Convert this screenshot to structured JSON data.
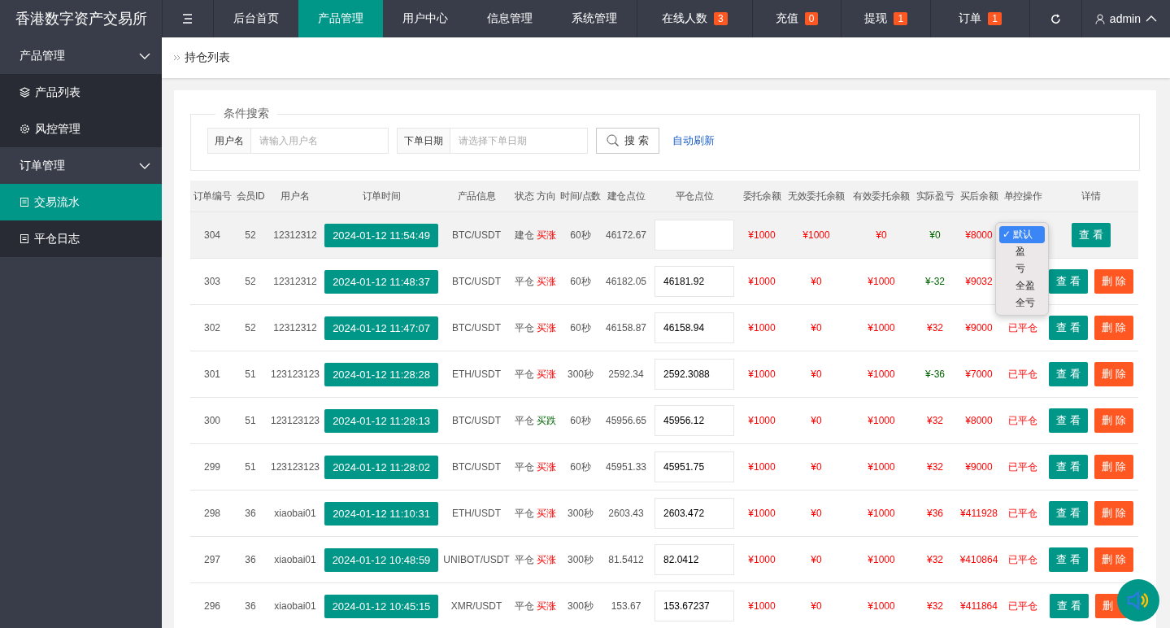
{
  "brand": "香港数字资产交易所",
  "top_nav": [
    {
      "label": "后台首页",
      "selected": false
    },
    {
      "label": "产品管理",
      "selected": true
    },
    {
      "label": "用户中心",
      "selected": false
    },
    {
      "label": "信息管理",
      "selected": false
    },
    {
      "label": "系统管理",
      "selected": false
    }
  ],
  "top_stats": [
    {
      "label": "在线人数",
      "count": "3"
    },
    {
      "label": "充值",
      "count": "0"
    },
    {
      "label": "提现",
      "count": "1"
    },
    {
      "label": "订单",
      "count": "1"
    }
  ],
  "user": "admin",
  "sidebar": [
    {
      "label": "产品管理",
      "expanded": true,
      "children": [
        {
          "label": "产品列表",
          "kind": "layers",
          "selected": false
        },
        {
          "label": "风控管理",
          "kind": "gear",
          "selected": false
        }
      ]
    },
    {
      "label": "订单管理",
      "expanded": true,
      "children": [
        {
          "label": "交易流水",
          "kind": "doc",
          "selected": true
        },
        {
          "label": "平仓日志",
          "kind": "doc",
          "selected": false
        }
      ]
    }
  ],
  "breadcrumb": "持仓列表",
  "search": {
    "legend": "条件搜索",
    "fields": [
      {
        "label": "用户名",
        "placeholder": "请输入用户名"
      },
      {
        "label": "下单日期",
        "placeholder": "请选择下单日期"
      }
    ],
    "button": "搜 索",
    "link": "自动刷新"
  },
  "table": {
    "columns": [
      "订单编号",
      "会员ID",
      "用户名",
      "订单时间",
      "产品信息",
      "状态",
      "方向",
      "时间/点数",
      "建仓点位",
      "平仓点位",
      "委托余额",
      "无效委托余额",
      "有效委托余额",
      "实际盈亏",
      "买后余额",
      "单控操作",
      "详情"
    ],
    "rows": [
      {
        "id": "304",
        "member": "52",
        "user": "12312312",
        "time": "2024-01-12 11:54:49",
        "product": "BTC/USDT",
        "status": "建仓",
        "direction": "买涨",
        "up": true,
        "period": "60秒",
        "open": "46172.67",
        "close": "",
        "amount": "¥1000",
        "invalid": "¥1000",
        "valid": "¥0",
        "pnl": "¥0",
        "pnl_loss": true,
        "balance": "¥8000",
        "control": {
          "kind": "menu",
          "options": [
            {
              "label": "默认",
              "mark": "✓",
              "selected": true
            },
            {
              "label": "盈",
              "selected": false
            },
            {
              "label": "亏",
              "selected": false
            },
            {
              "label": "全盈",
              "selected": false
            },
            {
              "label": "全亏",
              "selected": false
            }
          ]
        },
        "actions": [
          "查 看"
        ],
        "highlighted": true
      },
      {
        "id": "303",
        "member": "52",
        "user": "12312312",
        "time": "2024-01-12 11:48:37",
        "product": "BTC/USDT",
        "status": "平仓",
        "direction": "买涨",
        "up": true,
        "period": "60秒",
        "open": "46182.05",
        "close": "46181.92",
        "amount": "¥1000",
        "invalid": "¥0",
        "valid": "¥1000",
        "pnl": "¥-32",
        "pnl_loss": true,
        "balance": "¥9032",
        "control": {
          "kind": "hidden"
        },
        "actions": [
          "查 看",
          "删 除"
        ],
        "highlighted": false
      },
      {
        "id": "302",
        "member": "52",
        "user": "12312312",
        "time": "2024-01-12 11:47:07",
        "product": "BTC/USDT",
        "status": "平仓",
        "direction": "买涨",
        "up": true,
        "period": "60秒",
        "open": "46158.87",
        "close": "46158.94",
        "amount": "¥1000",
        "invalid": "¥0",
        "valid": "¥1000",
        "pnl": "¥32",
        "pnl_loss": false,
        "balance": "¥9000",
        "control": {
          "kind": "text",
          "label": "已平仓"
        },
        "actions": [
          "查 看",
          "删 除"
        ],
        "highlighted": false
      },
      {
        "id": "301",
        "member": "51",
        "user": "123123123",
        "time": "2024-01-12 11:28:28",
        "product": "ETH/USDT",
        "status": "平仓",
        "direction": "买涨",
        "up": true,
        "period": "300秒",
        "open": "2592.34",
        "close": "2592.3088",
        "amount": "¥1000",
        "invalid": "¥0",
        "valid": "¥1000",
        "pnl": "¥-36",
        "pnl_loss": true,
        "balance": "¥7000",
        "control": {
          "kind": "text",
          "label": "已平仓"
        },
        "actions": [
          "查 看",
          "删 除"
        ],
        "highlighted": false
      },
      {
        "id": "300",
        "member": "51",
        "user": "123123123",
        "time": "2024-01-12 11:28:13",
        "product": "BTC/USDT",
        "status": "平仓",
        "direction": "买跌",
        "up": false,
        "period": "60秒",
        "open": "45956.65",
        "close": "45956.12",
        "amount": "¥1000",
        "invalid": "¥0",
        "valid": "¥1000",
        "pnl": "¥32",
        "pnl_loss": false,
        "balance": "¥8000",
        "control": {
          "kind": "text",
          "label": "已平仓"
        },
        "actions": [
          "查 看",
          "删 除"
        ],
        "highlighted": false
      },
      {
        "id": "299",
        "member": "51",
        "user": "123123123",
        "time": "2024-01-12 11:28:02",
        "product": "BTC/USDT",
        "status": "平仓",
        "direction": "买涨",
        "up": true,
        "period": "60秒",
        "open": "45951.33",
        "close": "45951.75",
        "amount": "¥1000",
        "invalid": "¥0",
        "valid": "¥1000",
        "pnl": "¥32",
        "pnl_loss": false,
        "balance": "¥9000",
        "control": {
          "kind": "text",
          "label": "已平仓"
        },
        "actions": [
          "查 看",
          "删 除"
        ],
        "highlighted": false
      },
      {
        "id": "298",
        "member": "36",
        "user": "xiaobai01",
        "time": "2024-01-12 11:10:31",
        "product": "ETH/USDT",
        "status": "平仓",
        "direction": "买涨",
        "up": true,
        "period": "300秒",
        "open": "2603.43",
        "close": "2603.472",
        "amount": "¥1000",
        "invalid": "¥0",
        "valid": "¥1000",
        "pnl": "¥36",
        "pnl_loss": false,
        "balance": "¥411928",
        "control": {
          "kind": "text",
          "label": "已平仓"
        },
        "actions": [
          "查 看",
          "删 除"
        ],
        "highlighted": false
      },
      {
        "id": "297",
        "member": "36",
        "user": "xiaobai01",
        "time": "2024-01-12 10:48:59",
        "product": "UNIBOT/USDT",
        "status": "平仓",
        "direction": "买涨",
        "up": true,
        "period": "300秒",
        "open": "81.5412",
        "close": "82.0412",
        "amount": "¥1000",
        "invalid": "¥0",
        "valid": "¥1000",
        "pnl": "¥32",
        "pnl_loss": false,
        "balance": "¥410864",
        "control": {
          "kind": "text",
          "label": "已平仓"
        },
        "actions": [
          "查 看",
          "删 除"
        ],
        "highlighted": false
      },
      {
        "id": "296",
        "member": "36",
        "user": "xiaobai01",
        "time": "2024-01-12 10:45:15",
        "product": "XMR/USDT",
        "status": "平仓",
        "direction": "买涨",
        "up": true,
        "period": "300秒",
        "open": "153.67",
        "close": "153.67237",
        "amount": "¥1000",
        "invalid": "¥0",
        "valid": "¥1000",
        "pnl": "¥32",
        "pnl_loss": false,
        "balance": "¥411864",
        "control": {
          "kind": "text",
          "label": "已平仓"
        },
        "actions": [
          "查 看",
          "删"
        ],
        "highlighted": false
      }
    ]
  }
}
